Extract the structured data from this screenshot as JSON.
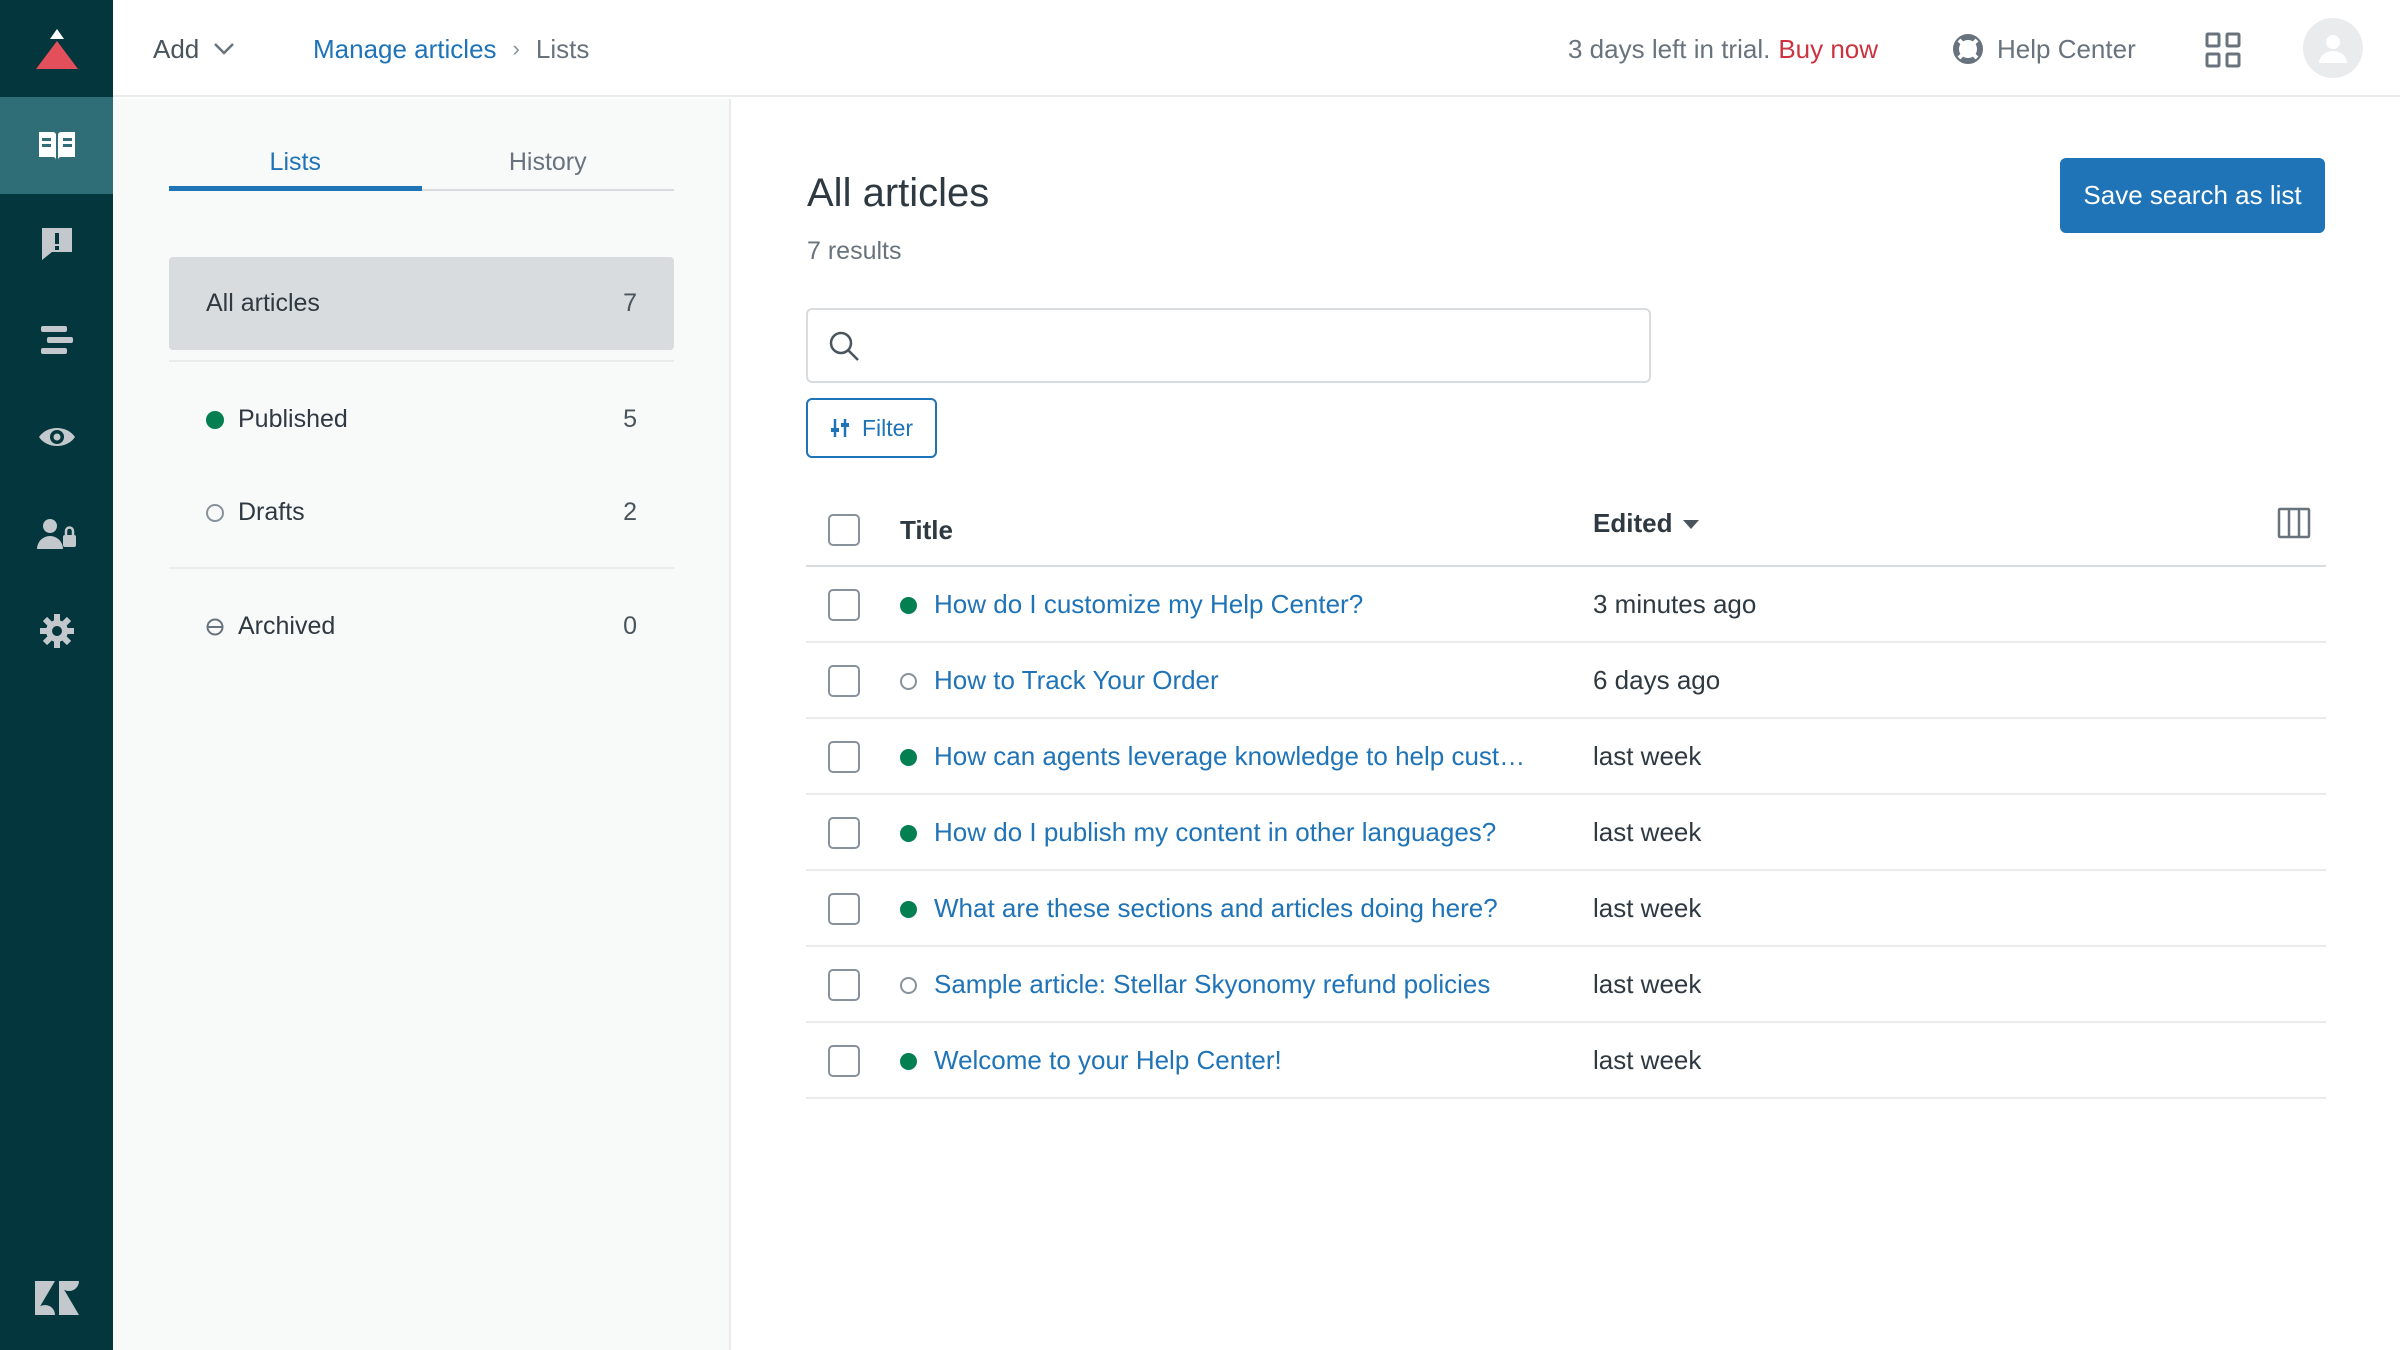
{
  "rail": {
    "items": [
      {
        "name": "knowledge-icon",
        "active": true
      },
      {
        "name": "alert-icon",
        "active": false
      },
      {
        "name": "arrange-icon",
        "active": false
      },
      {
        "name": "eye-icon",
        "active": false
      },
      {
        "name": "user-permissions-icon",
        "active": false
      },
      {
        "name": "gear-icon",
        "active": false
      }
    ]
  },
  "topbar": {
    "add_label": "Add",
    "breadcrumb": {
      "link": "Manage articles",
      "current": "Lists"
    },
    "trial_text": "3 days left in trial.",
    "buy_label": "Buy now",
    "help_center_label": "Help Center"
  },
  "panel": {
    "tabs": [
      {
        "label": "Lists"
      },
      {
        "label": "History"
      }
    ],
    "all": {
      "label": "All articles",
      "count": "7"
    },
    "published": {
      "label": "Published",
      "count": "5"
    },
    "drafts": {
      "label": "Drafts",
      "count": "2"
    },
    "archived": {
      "label": "Archived",
      "count": "0"
    }
  },
  "main": {
    "title": "All articles",
    "results": "7 results",
    "save_label": "Save search as list",
    "search_placeholder": "",
    "filter_label": "Filter",
    "columns": {
      "title": "Title",
      "edited": "Edited"
    },
    "rows": [
      {
        "status": "published",
        "title": "How do I customize my Help Center?",
        "edited": "3 minutes ago"
      },
      {
        "status": "draft",
        "title": "How to Track Your Order",
        "edited": "6 days ago"
      },
      {
        "status": "published",
        "title": "How can agents leverage knowledge to help custo...",
        "edited": "last week"
      },
      {
        "status": "published",
        "title": "How do I publish my content in other languages?",
        "edited": "last week"
      },
      {
        "status": "published",
        "title": "What are these sections and articles doing here?",
        "edited": "last week"
      },
      {
        "status": "draft",
        "title": "Sample article: Stellar Skyonomy refund policies",
        "edited": "last week"
      },
      {
        "status": "published",
        "title": "Welcome to your Help Center!",
        "edited": "last week"
      }
    ]
  },
  "colors": {
    "rail": "#03363d",
    "rail_active": "#2f6e77",
    "accent": "#1f73b7",
    "published": "#037f52",
    "buy_now": "#cc3340",
    "logo_red": "#e34f5b"
  }
}
